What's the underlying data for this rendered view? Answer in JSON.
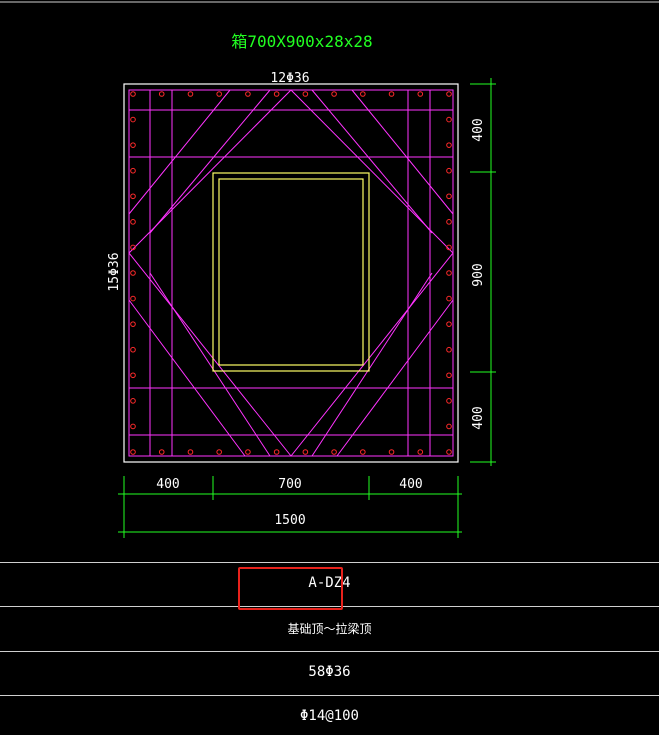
{
  "drawing": {
    "title": "箱700X900x28x28",
    "top_rebar_label": "12Φ36",
    "side_rebar_label": "15Φ36",
    "dims_right": [
      "400",
      "900",
      "400"
    ],
    "dims_bottom": [
      "400",
      "700",
      "400"
    ],
    "dim_total": "1500"
  },
  "table": {
    "column_id": "A-DZ4",
    "elevation_range": "基础顶～拉梁顶",
    "longitudinal_rebar": "58Φ36",
    "stirrups": "Φ14@100"
  },
  "colors": {
    "outline": "#ffffff",
    "stirrup": "#ff33ff",
    "rebar": "#ff2a2a",
    "steel_box": "#ffff66",
    "dimension": "#22ff22",
    "title": "#22ff22",
    "highlight": "#e8221c"
  }
}
